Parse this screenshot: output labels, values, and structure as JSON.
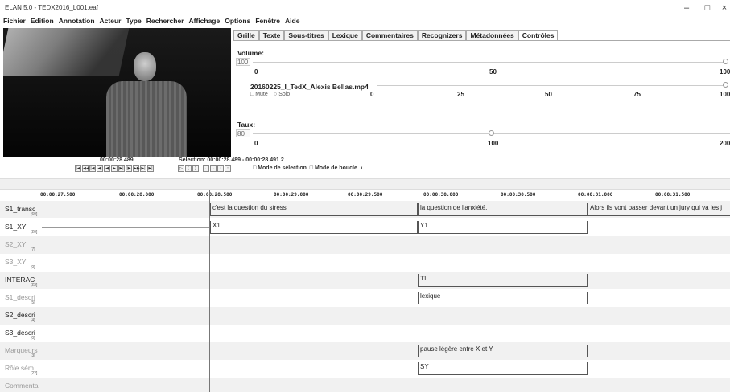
{
  "window": {
    "title": "ELAN 5.0 - TEDX2016_L001.eaf",
    "minimize": "–",
    "maximize": "□",
    "close": "×"
  },
  "menu": [
    "Fichier",
    "Edition",
    "Annotation",
    "Acteur",
    "Type",
    "Rechercher",
    "Affichage",
    "Options",
    "Fenêtre",
    "Aide"
  ],
  "tabs": [
    {
      "label": "Grille",
      "active": false
    },
    {
      "label": "Texte",
      "active": false
    },
    {
      "label": "Sous-titres",
      "active": false
    },
    {
      "label": "Lexique",
      "active": false
    },
    {
      "label": "Commentaires",
      "active": false
    },
    {
      "label": "Recognizers",
      "active": false
    },
    {
      "label": "Métadonnées",
      "active": false
    },
    {
      "label": "Contrôles",
      "active": true
    }
  ],
  "controls": {
    "volume_label": "Volume:",
    "volume_value": "100",
    "volume_ticks": [
      "0",
      "50",
      "100"
    ],
    "media_file": "20160225_I_TedX_Alexis Bellas.mp4",
    "media_ticks": [
      "0",
      "25",
      "50",
      "75",
      "100"
    ],
    "mute_label": "Mute",
    "solo_label": "Solo",
    "rate_label": "Taux:",
    "rate_value": "80",
    "rate_ticks": [
      "0",
      "100",
      "200"
    ],
    "rate_level": 0.5
  },
  "transport": {
    "current_time": "00:00:28.489",
    "selection": "Sélection: 00:00:28.489 - 00:00:28.491  2",
    "selection_mode": "Mode de sélection",
    "loop_mode": "Mode de boucle"
  },
  "ruler_ticks": [
    "00:00:27.500",
    "00:00:28.000",
    "00:00:28.500",
    "00:00:29.000",
    "00:00:29.500",
    "00:00:30.000",
    "00:00:30.500",
    "00:00:31.000",
    "00:00:31.500"
  ],
  "tiers": [
    {
      "name": "S1_transc",
      "count": "[60]",
      "grey": false
    },
    {
      "name": "S1_XY",
      "count": "[20]",
      "grey": false
    },
    {
      "name": "S2_XY",
      "count": "[7]",
      "grey": true
    },
    {
      "name": "S3_XY",
      "count": "[0]",
      "grey": true
    },
    {
      "name": "INTERAC",
      "count": "[23]",
      "grey": false
    },
    {
      "name": "S1_descri",
      "count": "[5]",
      "grey": true
    },
    {
      "name": "S2_descri",
      "count": "[4]",
      "grey": false
    },
    {
      "name": "S3_descri",
      "count": "[0]",
      "grey": false
    },
    {
      "name": "Marqueurs",
      "count": "[3]",
      "grey": true
    },
    {
      "name": "Rôle sém.",
      "count": "[22]",
      "grey": true
    },
    {
      "name": "Commenta",
      "count": "",
      "grey": true
    }
  ],
  "annotations": {
    "transc_1": "c'est la question du stress",
    "transc_2": "la question de l'anxiété.",
    "transc_3": "Alors ils vont passer devant un jury qui va les j",
    "xy_1": "X1",
    "xy_2": "Y1",
    "interac_1": "11",
    "descri_1": "lexique",
    "marqueurs_1": "pause légère entre X et Y",
    "role_1": "SY"
  }
}
